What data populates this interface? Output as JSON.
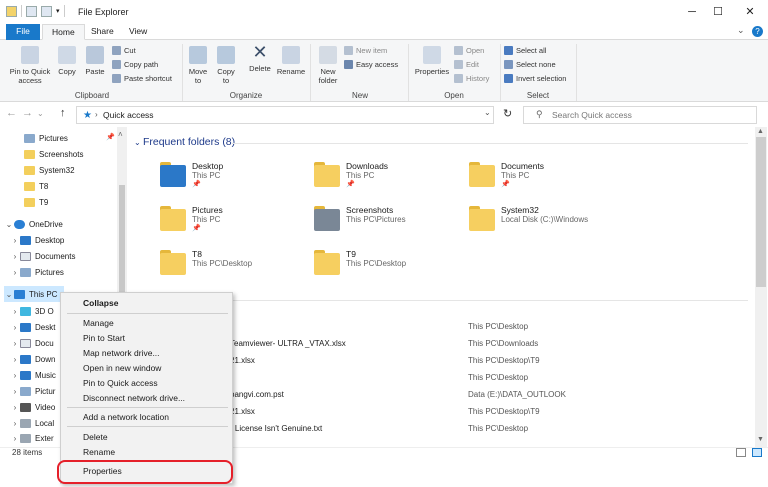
{
  "window": {
    "title": "File Explorer",
    "min": "─",
    "max": "☐",
    "close": "✕",
    "expand": "⌄",
    "help": "?"
  },
  "tabs": [
    "File",
    "Home",
    "Share",
    "View"
  ],
  "ribbon": {
    "clipboard": {
      "pin": "Pin to Quick access",
      "copy": "Copy",
      "paste": "Paste",
      "cut": "Cut",
      "copy_path": "Copy path",
      "paste_shortcut": "Paste shortcut",
      "group": "Clipboard"
    },
    "organize": {
      "move_to": "Move to",
      "copy_to": "Copy to",
      "delete": "Delete",
      "rename": "Rename",
      "group": "Organize"
    },
    "new": {
      "new_folder": "New folder",
      "new_item": "New item",
      "easy_access": "Easy access",
      "group": "New"
    },
    "open": {
      "properties": "Properties",
      "open": "Open",
      "edit": "Edit",
      "history": "History",
      "group": "Open"
    },
    "select": {
      "select_all": "Select all",
      "select_none": "Select none",
      "invert": "Invert selection",
      "group": "Select"
    }
  },
  "address": {
    "back": "←",
    "forward": "→",
    "recent": "⌄",
    "up": "↑",
    "path": "Quick access",
    "dropdown": "⌄",
    "refresh": "↻",
    "search_placeholder": "Search Quick access"
  },
  "nav": {
    "quick": [
      {
        "label": "Pictures",
        "pin": "📌"
      },
      {
        "label": "Screenshots"
      },
      {
        "label": "System32"
      },
      {
        "label": "T8"
      },
      {
        "label": "T9"
      }
    ],
    "onedrive": "OneDrive",
    "onedrive_items": [
      "Desktop",
      "Documents",
      "Pictures"
    ],
    "thispc": "This PC",
    "thispc_items": [
      "3D O",
      "Deskt",
      "Docu",
      "Down",
      "Music",
      "Pictur",
      "Video",
      "Local",
      "Exter"
    ]
  },
  "frequent": {
    "header": "Frequent folders (8)",
    "folders": [
      {
        "name": "Desktop",
        "loc": "This PC"
      },
      {
        "name": "Downloads",
        "loc": "This PC"
      },
      {
        "name": "Documents",
        "loc": "This PC"
      },
      {
        "name": "Pictures",
        "loc": "This PC"
      },
      {
        "name": "Screenshots",
        "loc": "This PC\\Pictures"
      },
      {
        "name": "System32",
        "loc": "Local Disk (C:)\\Windows"
      },
      {
        "name": "T8",
        "loc": "This PC\\Desktop"
      },
      {
        "name": "T9",
        "loc": "This PC\\Desktop"
      }
    ]
  },
  "recent": [
    {
      "name": "",
      "loc": "This PC\\Desktop"
    },
    {
      "name": "Teamviewer- ULTRA _VTAX.xlsx",
      "loc": "This PC\\Downloads"
    },
    {
      "name": "21.xlsx",
      "loc": "This PC\\Desktop\\T9"
    },
    {
      "name": "",
      "loc": "This PC\\Desktop"
    },
    {
      "name": "oangvi.com.pst",
      "loc": "Data (E:)\\DATA_OUTLOOK"
    },
    {
      "name": "21.xlsx",
      "loc": "This PC\\Desktop\\T9"
    },
    {
      "name": "r License Isn't Genuine.txt",
      "loc": "This PC\\Desktop"
    }
  ],
  "status": {
    "items": "28 items"
  },
  "context_menu": {
    "collapse": "Collapse",
    "manage": "Manage",
    "pin_start": "Pin to Start",
    "map_drive": "Map network drive...",
    "open_new": "Open in new window",
    "pin_quick": "Pin to Quick access",
    "disconnect": "Disconnect network drive...",
    "add_location": "Add a network location",
    "delete": "Delete",
    "rename": "Rename",
    "properties": "Properties"
  },
  "colors": {
    "accent": "#1979ca",
    "highlight": "#e5202a"
  }
}
